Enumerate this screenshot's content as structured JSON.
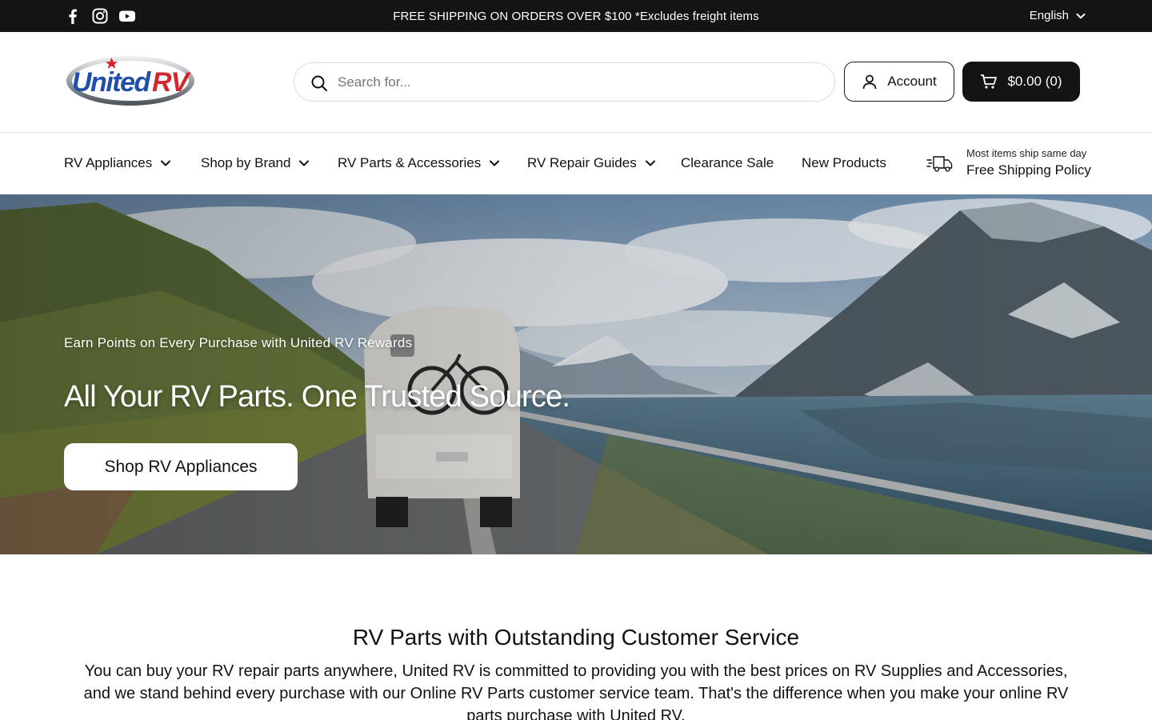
{
  "topbar": {
    "social": [
      "facebook-icon",
      "instagram-icon",
      "youtube-icon"
    ],
    "announcement": "FREE SHIPPING ON ORDERS OVER $100 *Excludes freight items",
    "language": "English"
  },
  "header": {
    "logo_text": "UnitedRV",
    "search_placeholder": "Search for...",
    "account_label": "Account",
    "cart_label": "$0.00 (0)"
  },
  "nav": {
    "items": [
      {
        "label": "RV Appliances",
        "dropdown": true
      },
      {
        "label": "Shop by Brand",
        "dropdown": true
      },
      {
        "label": "RV Parts & Accessories",
        "dropdown": true
      },
      {
        "label": "RV Repair Guides",
        "dropdown": true
      },
      {
        "label": "Clearance Sale",
        "dropdown": false
      },
      {
        "label": "New Products",
        "dropdown": false
      }
    ],
    "shipping_small": "Most items ship same day",
    "shipping_link": "Free Shipping Policy"
  },
  "hero": {
    "eyebrow": "Earn Points on Every Purchase with United RV Rewards",
    "headline": "All Your RV Parts. One Trusted Source.",
    "cta": "Shop RV Appliances"
  },
  "intro": {
    "heading": "RV Parts with Outstanding Customer Service",
    "body": "You can buy your RV repair parts anywhere, United RV is committed to providing you with the best prices on RV Supplies and Accessories, and we stand behind every purchase with our Online RV Parts customer service team. That's the difference when you make your online RV parts purchase with United RV."
  },
  "colors": {
    "topbar_bg": "#141414",
    "cart_bg": "#141414",
    "logo_blue": "#1f4fa8",
    "logo_red": "#d3262e"
  }
}
